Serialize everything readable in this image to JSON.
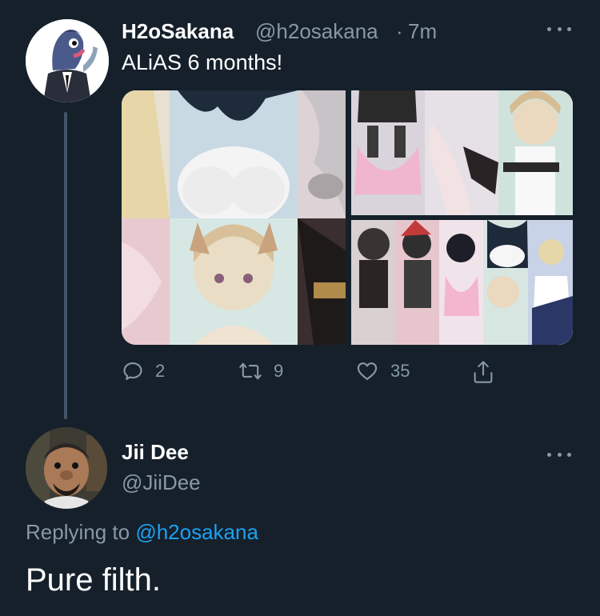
{
  "tweet": {
    "display_name": "H2oSakana",
    "handle": "@h2osakana",
    "separator": "·",
    "time": "7m",
    "text": "ALiAS 6 months!",
    "media_count": 3,
    "actions": {
      "replies": "2",
      "retweets": "9",
      "likes": "35"
    }
  },
  "reply": {
    "display_name": "Jii Dee",
    "handle": "@JiiDee",
    "replying_prefix": "Replying to",
    "replying_to": "@h2osakana",
    "text": "Pure filth."
  },
  "colors": {
    "background": "#15202b",
    "secondary_text": "#8899a6",
    "link": "#1da1f2",
    "thread_line": "#425466"
  }
}
